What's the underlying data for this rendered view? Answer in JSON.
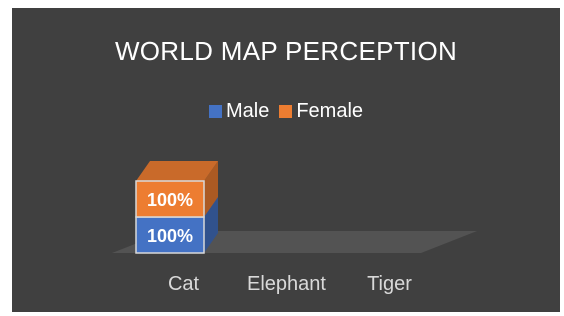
{
  "chart_data": {
    "type": "bar",
    "stacked": "percent",
    "view": "3d",
    "title": "WORLD MAP PERCEPTION",
    "categories": [
      "Cat",
      "Elephant",
      "Tiger"
    ],
    "series": [
      {
        "name": "Male",
        "color": "#4472c4",
        "values": [
          1,
          0,
          0
        ],
        "labels": [
          "100%",
          "",
          ""
        ]
      },
      {
        "name": "Female",
        "color": "#ed7d31",
        "values": [
          1,
          0,
          0
        ],
        "labels": [
          "100%",
          "",
          ""
        ]
      }
    ],
    "legend": "top",
    "grid": false,
    "background": "#404040"
  }
}
